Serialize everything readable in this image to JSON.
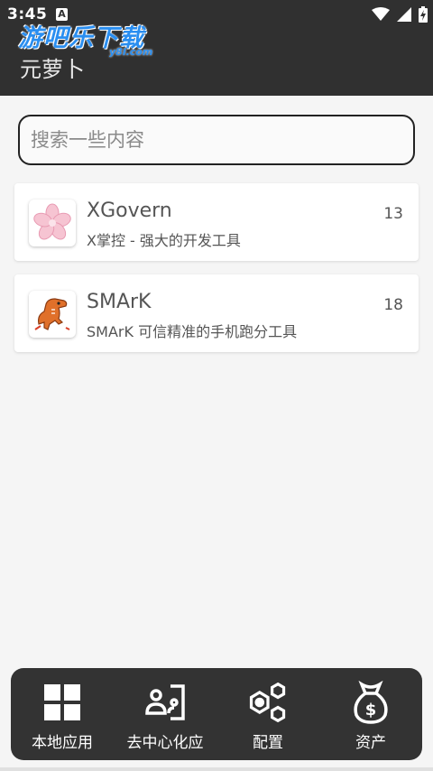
{
  "status_bar": {
    "time": "3:45",
    "notif_letter": "A"
  },
  "watermark": {
    "main": "游吧乐下载",
    "sub": "y8l.com"
  },
  "header": {
    "title": "元萝卜"
  },
  "search": {
    "placeholder": "搜索一些内容",
    "value": ""
  },
  "apps": [
    {
      "name": "XGovern",
      "description": "X掌控 - 强大的开发工具",
      "count": "13",
      "icon": "sakura-icon"
    },
    {
      "name": "SMArK",
      "description": "SMArK 可信精准的手机跑分工具",
      "count": "18",
      "icon": "dinosaur-icon"
    }
  ],
  "bottom_nav": [
    {
      "label": "本地应用",
      "icon": "grid-icon"
    },
    {
      "label": "去中心化应",
      "icon": "decentralized-icon"
    },
    {
      "label": "配置",
      "icon": "hexagon-settings-icon"
    },
    {
      "label": "资产",
      "icon": "money-bag-icon"
    }
  ],
  "colors": {
    "appbar": "#303030",
    "bottom_nav": "#333333",
    "watermark": "#2a8ef0"
  }
}
